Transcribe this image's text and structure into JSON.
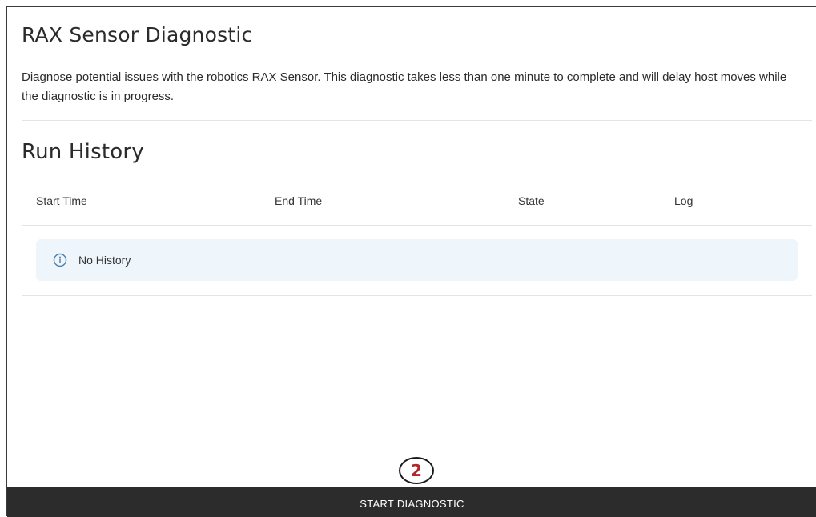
{
  "page": {
    "title": "RAX Sensor Diagnostic",
    "description": "Diagnose potential issues with the robotics RAX Sensor. This diagnostic takes less than one minute to complete and will delay host moves while the diagnostic is in progress."
  },
  "history": {
    "heading": "Run History",
    "columns": [
      "Start Time",
      "End Time",
      "State",
      "Log"
    ],
    "empty_icon": "info-icon",
    "empty_message": "No History"
  },
  "actions": {
    "start_label": "START DIAGNOSTIC"
  },
  "annotation": {
    "step_number": "2",
    "step_color": "#b3262c"
  },
  "colors": {
    "bar_background": "#2c2c2c",
    "alert_background": "#eef5fb",
    "info_icon": "#4a7fb0"
  }
}
